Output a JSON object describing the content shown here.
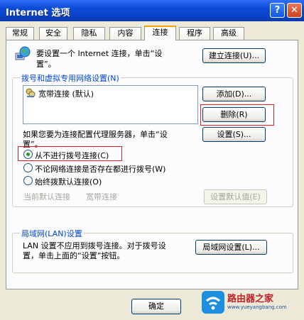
{
  "window": {
    "title": "Internet 选项",
    "help_label": "?",
    "close_label": "✕"
  },
  "tabs": [
    "常规",
    "安全",
    "隐私",
    "内容",
    "连接",
    "程序",
    "高级"
  ],
  "setup": {
    "text_line1": "要设置一个 Internet 连接，单击“设",
    "text_line2": "置”。",
    "button": "建立连接(U)..."
  },
  "dialup": {
    "legend": "拨号和虚拟专用网络设置(N)",
    "items": [
      "宽带连接 (默认)"
    ],
    "add_button": "添加(D)...",
    "remove_button": "删除(R)",
    "settings_button": "设置(S)...",
    "proxy_text_line1": "如果您要为连接配置代理服务器，单击“设",
    "proxy_text_line2": "置”。"
  },
  "radios": [
    {
      "label": "从不进行拨号连接(C)",
      "checked": true
    },
    {
      "label": "不论网络连接是否存在都进行拨号(W)",
      "checked": false
    },
    {
      "label": "始终拨默认连接(O)",
      "checked": false
    }
  ],
  "default_connection": {
    "label": "当前默认连接",
    "value": "宽带连接",
    "button": "设置默认值(E)"
  },
  "lan": {
    "legend": "局域网(LAN)设置",
    "text_line1": "LAN 设置不应用到拨号连接。对于拨号设",
    "text_line2": "置，单击上面的“设置”按钮。",
    "button": "局域网设置(L)..."
  },
  "footer": {
    "ok_button": "确定"
  },
  "watermark": {
    "site_name": "路由器之家",
    "site_url": "www.yueyangbang.com"
  }
}
